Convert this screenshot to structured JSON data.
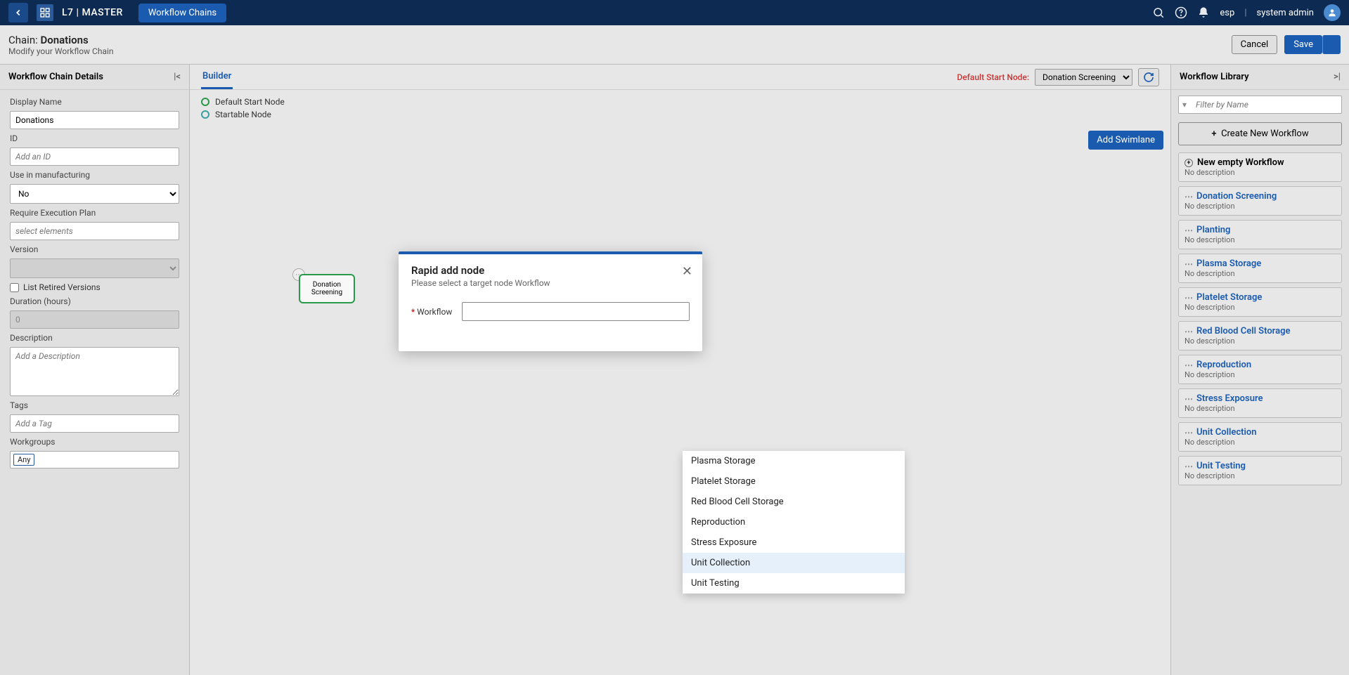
{
  "topbar": {
    "app_title": "L7 | MASTER",
    "tab_label": "Workflow Chains",
    "lang": "esp",
    "user": "system admin"
  },
  "subheader": {
    "prefix": "Chain: ",
    "name": "Donations",
    "subtitle": "Modify your Workflow Chain",
    "cancel": "Cancel",
    "save": "Save"
  },
  "details": {
    "title": "Workflow Chain Details",
    "display_name_label": "Display Name",
    "display_name_value": "Donations",
    "id_label": "ID",
    "id_placeholder": "Add an ID",
    "manufacturing_label": "Use in manufacturing",
    "manufacturing_value": "No",
    "exec_plan_label": "Require Execution Plan",
    "exec_plan_placeholder": "select elements",
    "version_label": "Version",
    "retired_label": "List Retired Versions",
    "duration_label": "Duration (hours)",
    "duration_value": "0",
    "desc_label": "Description",
    "desc_placeholder": "Add a Description",
    "tags_label": "Tags",
    "tags_placeholder": "Add a Tag",
    "workgroups_label": "Workgroups",
    "workgroups_value": "Any"
  },
  "builder": {
    "tab": "Builder",
    "default_start_label": "Default Start Node:",
    "default_start_value": "Donation Screening",
    "legend_default": "Default Start Node",
    "legend_startable": "Startable Node",
    "swimlane_btn": "Add Swimlane",
    "node_label": "Donation Screening"
  },
  "library": {
    "title": "Workflow Library",
    "filter_placeholder": "Filter by Name",
    "create_btn": "Create New Workflow",
    "no_desc": "No description",
    "items": [
      {
        "name": "New empty Workflow",
        "link": false,
        "plus": true
      },
      {
        "name": "Donation Screening",
        "link": true
      },
      {
        "name": "Planting",
        "link": true
      },
      {
        "name": "Plasma Storage",
        "link": true
      },
      {
        "name": "Platelet Storage",
        "link": true
      },
      {
        "name": "Red Blood Cell Storage",
        "link": true
      },
      {
        "name": "Reproduction",
        "link": true
      },
      {
        "name": "Stress Exposure",
        "link": true
      },
      {
        "name": "Unit Collection",
        "link": true
      },
      {
        "name": "Unit Testing",
        "link": true
      }
    ]
  },
  "modal": {
    "title": "Rapid add node",
    "subtitle": "Please select a target node Workflow",
    "field_label": "Workflow",
    "options": [
      "Plasma Storage",
      "Platelet Storage",
      "Red Blood Cell Storage",
      "Reproduction",
      "Stress Exposure",
      "Unit Collection",
      "Unit Testing"
    ],
    "highlighted": "Unit Collection"
  }
}
